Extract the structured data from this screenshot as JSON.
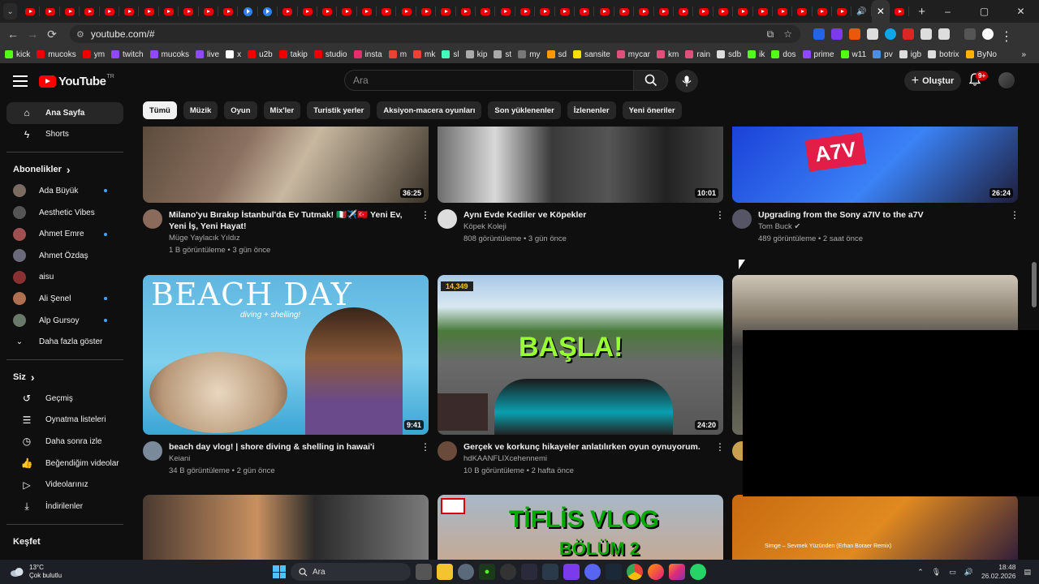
{
  "browser": {
    "url": "youtube.com/#",
    "new_tab": "+",
    "window_controls": [
      "–",
      "▢",
      "✕"
    ],
    "bookmarks": [
      {
        "label": "kick",
        "color": "#53fc18"
      },
      {
        "label": "mucoks",
        "color": "#e00"
      },
      {
        "label": "ym",
        "color": "#e00"
      },
      {
        "label": "twitch",
        "color": "#9146ff"
      },
      {
        "label": "mucoks",
        "color": "#9146ff"
      },
      {
        "label": "live",
        "color": "#9146ff"
      },
      {
        "label": "x",
        "color": "#ffffff"
      },
      {
        "label": "u2b",
        "color": "#e00"
      },
      {
        "label": "takip",
        "color": "#e00"
      },
      {
        "label": "studio",
        "color": "#e00"
      },
      {
        "label": "insta",
        "color": "#e1306c"
      },
      {
        "label": "m",
        "color": "#ea4335"
      },
      {
        "label": "mk",
        "color": "#ea4335"
      },
      {
        "label": "sl",
        "color": "#4fb"
      },
      {
        "label": "kip",
        "color": "#aaa"
      },
      {
        "label": "st",
        "color": "#aaa"
      },
      {
        "label": "my",
        "color": "#777"
      },
      {
        "label": "sd",
        "color": "#f90"
      },
      {
        "label": "sansite",
        "color": "#fd0"
      },
      {
        "label": "mycar",
        "color": "#e0507a"
      },
      {
        "label": "km",
        "color": "#e0507a"
      },
      {
        "label": "rain",
        "color": "#e0507a"
      },
      {
        "label": "sdb",
        "color": "#ddd"
      },
      {
        "label": "ik",
        "color": "#53fc18"
      },
      {
        "label": "dos",
        "color": "#53fc18"
      },
      {
        "label": "prime",
        "color": "#9146ff"
      },
      {
        "label": "w11",
        "color": "#53fc18"
      },
      {
        "label": "pv",
        "color": "#4a90e2"
      },
      {
        "label": "igb",
        "color": "#ddd"
      },
      {
        "label": "botrix",
        "color": "#ddd"
      },
      {
        "label": "ByNo",
        "color": "#ffb300"
      }
    ]
  },
  "header": {
    "logo_text": "YouTube",
    "logo_region": "TR",
    "search_placeholder": "Ara",
    "create_label": "Oluştur",
    "notif_badge": "9+"
  },
  "sidebar": {
    "main": [
      {
        "label": "Ana Sayfa",
        "icon": "home-icon",
        "active": true
      },
      {
        "label": "Shorts",
        "icon": "shorts-icon",
        "active": false
      }
    ],
    "subs_title": "Abonelikler",
    "subs": [
      {
        "label": "Ada Büyük",
        "color": "#7a6a60",
        "dot": true
      },
      {
        "label": "Aesthetic Vibes",
        "color": "#555",
        "dot": false
      },
      {
        "label": "Ahmet Emre",
        "color": "#a05050",
        "dot": true
      },
      {
        "label": "Ahmet Özdaş",
        "color": "#6a6a7a",
        "dot": false
      },
      {
        "label": "aisu",
        "color": "#8a3030",
        "dot": false
      },
      {
        "label": "Ali Şenel",
        "color": "#b07050",
        "dot": true
      },
      {
        "label": "Alp Gursoy",
        "color": "#6a7a6a",
        "dot": true
      }
    ],
    "show_more": "Daha fazla göster",
    "you_title": "Siz",
    "you": [
      {
        "label": "Geçmiş",
        "icon": "history-icon"
      },
      {
        "label": "Oynatma listeleri",
        "icon": "playlists-icon"
      },
      {
        "label": "Daha sonra izle",
        "icon": "watch-later-icon"
      },
      {
        "label": "Beğendiğim videolar",
        "icon": "like-icon"
      },
      {
        "label": "Videolarınız",
        "icon": "your-videos-icon"
      },
      {
        "label": "İndirilenler",
        "icon": "download-icon"
      }
    ],
    "explore_title": "Keşfet"
  },
  "chips": [
    "Tümü",
    "Müzik",
    "Oyun",
    "Mix'ler",
    "Turistik yerler",
    "Aksiyon-macera oyunları",
    "Son yüklenenler",
    "İzlenenler",
    "Yeni öneriler"
  ],
  "videos": [
    {
      "title": "Milano'yu Bırakıp İstanbul'da Ev Tutmak! 🇮🇹✈️🇹🇷 Yeni Ev, Yeni İş, Yeni Hayat!",
      "channel": "Müge Yaylacık Yıldız",
      "stats": "1 B görüntüleme • 3 gün önce",
      "duration": "36:25"
    },
    {
      "title": "Aynı Evde Kediler ve Köpekler",
      "channel": "Köpek Koleji",
      "stats": "808 görüntüleme • 3 gün önce",
      "duration": "10:01"
    },
    {
      "title": "Upgrading from the Sony a7IV to the a7V",
      "channel": "Tom Buck",
      "stats": "489 görüntüleme • 2 saat önce",
      "duration": "26:24",
      "thumb_text": "A7V"
    },
    {
      "title": "beach day vlog! | shore diving & shelling in hawai'i",
      "channel": "Keiani",
      "stats": "34 B görüntüleme • 2 gün önce",
      "duration": "9:41",
      "thumb_text": "BEACH DAY",
      "thumb_sub": "diving + shelling!"
    },
    {
      "title": "Gerçek ve korkunç hikayeler anlatılırken oyun oynuyorum.",
      "channel": "hdKAANFLIXcehennemi",
      "stats": "10 B görüntüleme • 2 hafta önce",
      "duration": "24:20",
      "thumb_text": "BAŞLA!",
      "hud_text": "14,349"
    },
    {
      "thumb_text": "TİFLİS VLOG",
      "thumb_sub": "BÖLÜM 2"
    },
    {
      "thumb_text": "Simge – Sevmek Yüzünden (Erhan Boraer Remix)"
    }
  ],
  "taskbar": {
    "temp": "13°C",
    "weather": "Çok bulutlu",
    "search": "Ara",
    "time": "18:48",
    "date": "26.02.2026"
  }
}
